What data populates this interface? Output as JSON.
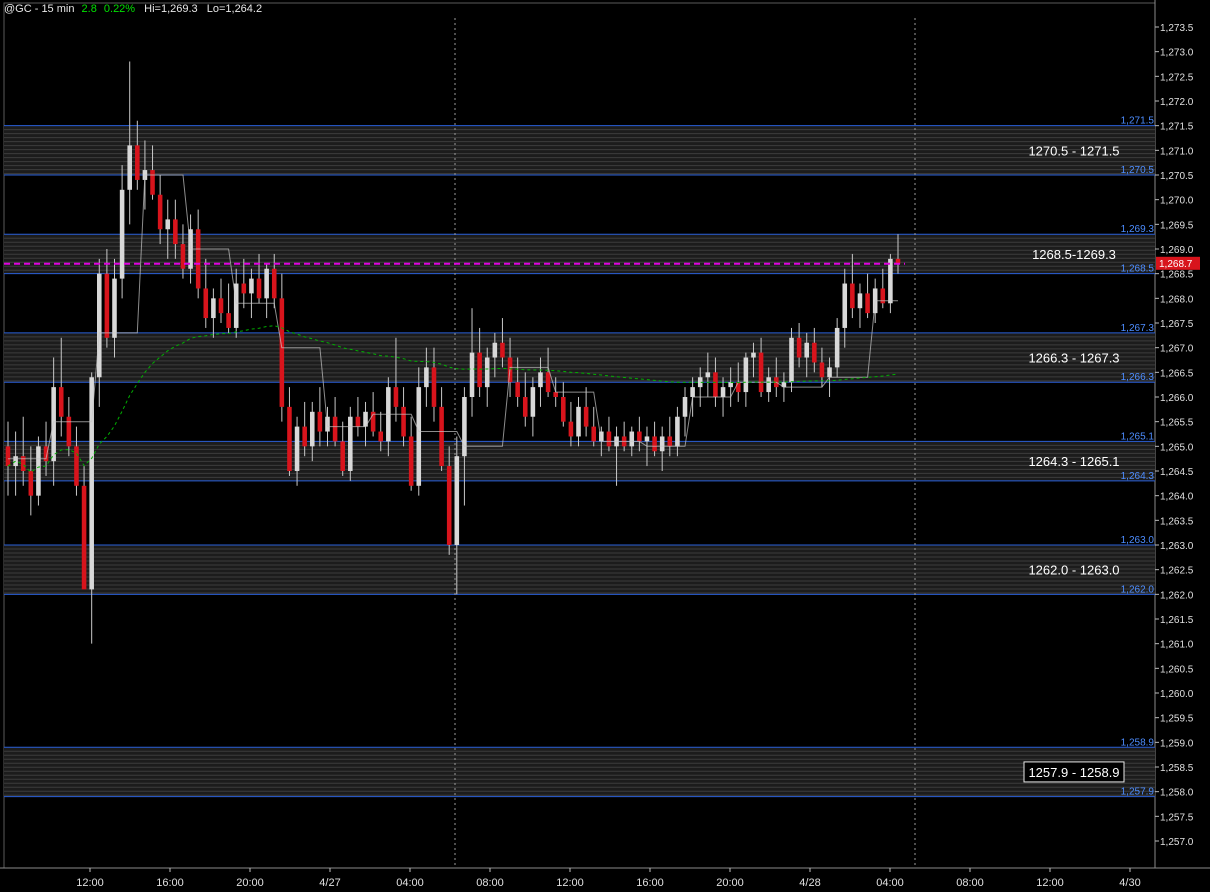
{
  "header": {
    "symbol": "@GC - 15 min",
    "change": "2.8",
    "change_pct": "0.22%",
    "high": "Hi=1,269.3",
    "low": "Lo=1,264.2"
  },
  "colors": {
    "background": "#000000",
    "zone_line": "#2a5fd8",
    "zone_label": "#4d8dff",
    "up_candle": "#d8d8d8",
    "down_candle": "#d8141c",
    "current_price_line": "#e000e0",
    "avg_line": "#00b000",
    "session_line": "#c8c8c8",
    "price_tag": "#d8141c"
  },
  "chart_data": {
    "type": "candlestick",
    "title": "@GC - 15 min",
    "x_ticks": [
      "12:00",
      "16:00",
      "20:00",
      "4/27",
      "04:00",
      "08:00",
      "12:00",
      "16:00",
      "20:00",
      "4/28",
      "04:00",
      "08:00",
      "12:00",
      "4/30"
    ],
    "y_ticks": [
      "1,257.0",
      "1,257.5",
      "1,258.0",
      "1,258.5",
      "1,259.0",
      "1,259.5",
      "1,260.0",
      "1,260.5",
      "1,261.0",
      "1,261.5",
      "1,262.0",
      "1,262.5",
      "1,263.0",
      "1,263.5",
      "1,264.0",
      "1,264.5",
      "1,265.0",
      "1,265.5",
      "1,266.0",
      "1,266.5",
      "1,267.0",
      "1,267.5",
      "1,268.0",
      "1,268.5",
      "1,269.0",
      "1,269.5",
      "1,270.0",
      "1,270.5",
      "1,271.0",
      "1,271.5",
      "1,272.0",
      "1,272.5",
      "1,273.0",
      "1,273.5"
    ],
    "ylim": [
      1256.6,
      1273.8
    ],
    "current_price": "1,268.7",
    "current_price_value": 1268.7,
    "zones": [
      {
        "label": "1270.5 - 1271.5",
        "low": 1270.5,
        "high": 1271.5,
        "low_label": "1,270.5",
        "high_label": "1,271.5",
        "boxed": false
      },
      {
        "label": "1268.5-1269.3",
        "low": 1268.5,
        "high": 1269.3,
        "low_label": "1,268.5",
        "high_label": "1,269.3",
        "boxed": false
      },
      {
        "label": "1266.3 - 1267.3",
        "low": 1266.3,
        "high": 1267.3,
        "low_label": "1,266.3",
        "high_label": "1,267.3",
        "boxed": false
      },
      {
        "label": "1264.3 - 1265.1",
        "low": 1264.3,
        "high": 1265.1,
        "low_label": "1,264.3",
        "high_label": "1,265.1",
        "boxed": false
      },
      {
        "label": "1262.0 - 1263.0",
        "low": 1262.0,
        "high": 1263.0,
        "low_label": "1,262.0",
        "high_label": "1,263.0",
        "boxed": false
      },
      {
        "label": "1257.9 - 1258.9",
        "low": 1257.9,
        "high": 1258.9,
        "low_label": "1,257.9",
        "high_label": "1,258.9",
        "boxed": true
      }
    ],
    "candles": [
      {
        "o": 1265.0,
        "h": 1265.5,
        "l": 1264.0,
        "c": 1264.6
      },
      {
        "o": 1264.6,
        "h": 1265.3,
        "l": 1264.0,
        "c": 1264.8
      },
      {
        "o": 1264.8,
        "h": 1265.6,
        "l": 1264.2,
        "c": 1264.5
      },
      {
        "o": 1264.5,
        "h": 1265.0,
        "l": 1263.6,
        "c": 1264.0
      },
      {
        "o": 1264.0,
        "h": 1265.2,
        "l": 1263.8,
        "c": 1265.0
      },
      {
        "o": 1265.0,
        "h": 1265.5,
        "l": 1264.4,
        "c": 1264.7
      },
      {
        "o": 1264.7,
        "h": 1266.8,
        "l": 1264.2,
        "c": 1266.2
      },
      {
        "o": 1266.2,
        "h": 1267.2,
        "l": 1265.2,
        "c": 1265.6
      },
      {
        "o": 1265.6,
        "h": 1266.0,
        "l": 1264.8,
        "c": 1265.0
      },
      {
        "o": 1265.0,
        "h": 1265.4,
        "l": 1264.0,
        "c": 1264.2
      },
      {
        "o": 1264.2,
        "h": 1264.6,
        "l": 1262.2,
        "c": 1262.1
      },
      {
        "o": 1262.1,
        "h": 1266.5,
        "l": 1261.0,
        "c": 1266.4
      },
      {
        "o": 1266.4,
        "h": 1268.8,
        "l": 1265.8,
        "c": 1268.5
      },
      {
        "o": 1268.5,
        "h": 1269.0,
        "l": 1267.0,
        "c": 1267.2
      },
      {
        "o": 1267.2,
        "h": 1268.8,
        "l": 1266.8,
        "c": 1268.4
      },
      {
        "o": 1268.4,
        "h": 1270.7,
        "l": 1268.0,
        "c": 1270.2
      },
      {
        "o": 1270.2,
        "h": 1272.8,
        "l": 1269.5,
        "c": 1271.1
      },
      {
        "o": 1271.1,
        "h": 1271.6,
        "l": 1270.2,
        "c": 1270.4
      },
      {
        "o": 1270.4,
        "h": 1271.2,
        "l": 1269.8,
        "c": 1270.6
      },
      {
        "o": 1270.6,
        "h": 1271.1,
        "l": 1270.0,
        "c": 1270.1
      },
      {
        "o": 1270.1,
        "h": 1270.5,
        "l": 1269.1,
        "c": 1269.4
      },
      {
        "o": 1269.4,
        "h": 1270.0,
        "l": 1268.8,
        "c": 1269.6
      },
      {
        "o": 1269.6,
        "h": 1270.0,
        "l": 1268.8,
        "c": 1269.1
      },
      {
        "o": 1269.1,
        "h": 1269.5,
        "l": 1268.4,
        "c": 1268.6
      },
      {
        "o": 1268.6,
        "h": 1269.7,
        "l": 1268.3,
        "c": 1269.4
      },
      {
        "o": 1269.4,
        "h": 1269.8,
        "l": 1268.0,
        "c": 1268.2
      },
      {
        "o": 1268.2,
        "h": 1268.8,
        "l": 1267.4,
        "c": 1267.6
      },
      {
        "o": 1267.6,
        "h": 1268.2,
        "l": 1267.2,
        "c": 1268.0
      },
      {
        "o": 1268.0,
        "h": 1268.4,
        "l": 1267.5,
        "c": 1267.7
      },
      {
        "o": 1267.7,
        "h": 1268.3,
        "l": 1267.3,
        "c": 1267.4
      },
      {
        "o": 1267.4,
        "h": 1268.6,
        "l": 1267.2,
        "c": 1268.3
      },
      {
        "o": 1268.3,
        "h": 1268.8,
        "l": 1267.8,
        "c": 1268.1
      },
      {
        "o": 1268.1,
        "h": 1268.6,
        "l": 1267.6,
        "c": 1268.4
      },
      {
        "o": 1268.4,
        "h": 1268.9,
        "l": 1267.9,
        "c": 1268.0
      },
      {
        "o": 1268.0,
        "h": 1268.7,
        "l": 1267.6,
        "c": 1268.6
      },
      {
        "o": 1268.6,
        "h": 1268.9,
        "l": 1267.8,
        "c": 1268.0
      },
      {
        "o": 1268.0,
        "h": 1268.5,
        "l": 1265.5,
        "c": 1265.8
      },
      {
        "o": 1265.8,
        "h": 1266.2,
        "l": 1264.4,
        "c": 1264.5
      },
      {
        "o": 1264.5,
        "h": 1265.6,
        "l": 1264.2,
        "c": 1265.4
      },
      {
        "o": 1265.4,
        "h": 1265.9,
        "l": 1264.8,
        "c": 1265.0
      },
      {
        "o": 1265.0,
        "h": 1265.9,
        "l": 1264.7,
        "c": 1265.7
      },
      {
        "o": 1265.7,
        "h": 1266.2,
        "l": 1265.0,
        "c": 1265.3
      },
      {
        "o": 1265.3,
        "h": 1265.8,
        "l": 1265.0,
        "c": 1265.6
      },
      {
        "o": 1265.6,
        "h": 1266.0,
        "l": 1265.0,
        "c": 1265.1
      },
      {
        "o": 1265.1,
        "h": 1265.5,
        "l": 1264.4,
        "c": 1264.5
      },
      {
        "o": 1264.5,
        "h": 1265.8,
        "l": 1264.3,
        "c": 1265.6
      },
      {
        "o": 1265.6,
        "h": 1266.0,
        "l": 1265.2,
        "c": 1265.4
      },
      {
        "o": 1265.4,
        "h": 1265.9,
        "l": 1265.0,
        "c": 1265.7
      },
      {
        "o": 1265.7,
        "h": 1266.1,
        "l": 1265.2,
        "c": 1265.3
      },
      {
        "o": 1265.3,
        "h": 1265.7,
        "l": 1264.9,
        "c": 1265.1
      },
      {
        "o": 1265.1,
        "h": 1266.4,
        "l": 1264.8,
        "c": 1266.2
      },
      {
        "o": 1266.2,
        "h": 1267.2,
        "l": 1265.5,
        "c": 1265.8
      },
      {
        "o": 1265.8,
        "h": 1266.2,
        "l": 1265.0,
        "c": 1265.2
      },
      {
        "o": 1265.2,
        "h": 1265.6,
        "l": 1264.1,
        "c": 1264.2
      },
      {
        "o": 1264.2,
        "h": 1266.6,
        "l": 1264.0,
        "c": 1266.2
      },
      {
        "o": 1266.2,
        "h": 1267.0,
        "l": 1265.8,
        "c": 1266.6
      },
      {
        "o": 1266.6,
        "h": 1267.0,
        "l": 1265.5,
        "c": 1265.8
      },
      {
        "o": 1265.8,
        "h": 1266.2,
        "l": 1264.5,
        "c": 1264.6
      },
      {
        "o": 1264.6,
        "h": 1265.0,
        "l": 1262.8,
        "c": 1263.0
      },
      {
        "o": 1263.0,
        "h": 1265.2,
        "l": 1262.0,
        "c": 1264.8
      },
      {
        "o": 1264.8,
        "h": 1266.2,
        "l": 1263.8,
        "c": 1266.0
      },
      {
        "o": 1266.0,
        "h": 1267.8,
        "l": 1265.6,
        "c": 1266.9
      },
      {
        "o": 1266.9,
        "h": 1267.4,
        "l": 1266.0,
        "c": 1266.2
      },
      {
        "o": 1266.2,
        "h": 1267.0,
        "l": 1265.8,
        "c": 1266.8
      },
      {
        "o": 1266.8,
        "h": 1267.3,
        "l": 1266.4,
        "c": 1267.1
      },
      {
        "o": 1267.1,
        "h": 1267.6,
        "l": 1266.6,
        "c": 1266.8
      },
      {
        "o": 1266.8,
        "h": 1267.2,
        "l": 1266.0,
        "c": 1266.3
      },
      {
        "o": 1266.3,
        "h": 1266.8,
        "l": 1265.8,
        "c": 1266.0
      },
      {
        "o": 1266.0,
        "h": 1266.5,
        "l": 1265.4,
        "c": 1265.6
      },
      {
        "o": 1265.6,
        "h": 1266.4,
        "l": 1265.2,
        "c": 1266.2
      },
      {
        "o": 1266.2,
        "h": 1266.8,
        "l": 1265.8,
        "c": 1266.5
      },
      {
        "o": 1266.5,
        "h": 1267.0,
        "l": 1266.0,
        "c": 1266.1
      },
      {
        "o": 1266.1,
        "h": 1266.4,
        "l": 1265.8,
        "c": 1266.0
      },
      {
        "o": 1266.0,
        "h": 1266.3,
        "l": 1265.4,
        "c": 1265.5
      },
      {
        "o": 1265.5,
        "h": 1265.9,
        "l": 1265.0,
        "c": 1265.2
      },
      {
        "o": 1265.2,
        "h": 1266.0,
        "l": 1265.0,
        "c": 1265.8
      },
      {
        "o": 1265.8,
        "h": 1266.2,
        "l": 1265.2,
        "c": 1265.4
      },
      {
        "o": 1265.4,
        "h": 1265.8,
        "l": 1265.0,
        "c": 1265.1
      },
      {
        "o": 1265.1,
        "h": 1265.4,
        "l": 1264.8,
        "c": 1265.3
      },
      {
        "o": 1265.3,
        "h": 1265.6,
        "l": 1264.9,
        "c": 1265.0
      },
      {
        "o": 1265.0,
        "h": 1265.4,
        "l": 1264.2,
        "c": 1265.2
      },
      {
        "o": 1265.2,
        "h": 1265.5,
        "l": 1264.9,
        "c": 1265.0
      },
      {
        "o": 1265.0,
        "h": 1265.4,
        "l": 1264.8,
        "c": 1265.3
      },
      {
        "o": 1265.3,
        "h": 1265.6,
        "l": 1264.9,
        "c": 1265.1
      },
      {
        "o": 1265.1,
        "h": 1265.4,
        "l": 1264.6,
        "c": 1265.2
      },
      {
        "o": 1265.2,
        "h": 1265.5,
        "l": 1264.8,
        "c": 1264.9
      },
      {
        "o": 1264.9,
        "h": 1265.4,
        "l": 1264.5,
        "c": 1265.2
      },
      {
        "o": 1265.2,
        "h": 1265.6,
        "l": 1264.8,
        "c": 1265.0
      },
      {
        "o": 1265.0,
        "h": 1265.8,
        "l": 1264.8,
        "c": 1265.6
      },
      {
        "o": 1265.6,
        "h": 1266.2,
        "l": 1265.2,
        "c": 1266.0
      },
      {
        "o": 1266.0,
        "h": 1266.4,
        "l": 1265.6,
        "c": 1266.2
      },
      {
        "o": 1266.2,
        "h": 1266.6,
        "l": 1265.8,
        "c": 1266.4
      },
      {
        "o": 1266.4,
        "h": 1266.9,
        "l": 1266.0,
        "c": 1266.5
      },
      {
        "o": 1266.5,
        "h": 1266.8,
        "l": 1265.8,
        "c": 1266.0
      },
      {
        "o": 1266.0,
        "h": 1266.4,
        "l": 1265.6,
        "c": 1266.2
      },
      {
        "o": 1266.2,
        "h": 1266.6,
        "l": 1265.8,
        "c": 1266.3
      },
      {
        "o": 1266.3,
        "h": 1266.7,
        "l": 1265.9,
        "c": 1266.1
      },
      {
        "o": 1266.1,
        "h": 1266.9,
        "l": 1265.8,
        "c": 1266.8
      },
      {
        "o": 1266.8,
        "h": 1267.1,
        "l": 1266.4,
        "c": 1266.9
      },
      {
        "o": 1266.9,
        "h": 1267.2,
        "l": 1266.0,
        "c": 1266.1
      },
      {
        "o": 1266.1,
        "h": 1266.6,
        "l": 1265.9,
        "c": 1266.4
      },
      {
        "o": 1266.4,
        "h": 1266.8,
        "l": 1266.0,
        "c": 1266.2
      },
      {
        "o": 1266.2,
        "h": 1266.5,
        "l": 1265.9,
        "c": 1266.3
      },
      {
        "o": 1266.3,
        "h": 1267.4,
        "l": 1266.1,
        "c": 1267.2
      },
      {
        "o": 1267.2,
        "h": 1267.5,
        "l": 1266.6,
        "c": 1266.8
      },
      {
        "o": 1266.8,
        "h": 1267.3,
        "l": 1266.4,
        "c": 1267.1
      },
      {
        "o": 1267.1,
        "h": 1267.4,
        "l": 1266.5,
        "c": 1266.7
      },
      {
        "o": 1266.7,
        "h": 1267.0,
        "l": 1266.2,
        "c": 1266.4
      },
      {
        "o": 1266.4,
        "h": 1266.8,
        "l": 1266.0,
        "c": 1266.6
      },
      {
        "o": 1266.6,
        "h": 1267.6,
        "l": 1266.4,
        "c": 1267.4
      },
      {
        "o": 1267.4,
        "h": 1268.6,
        "l": 1267.0,
        "c": 1268.3
      },
      {
        "o": 1268.3,
        "h": 1268.9,
        "l": 1267.6,
        "c": 1267.8
      },
      {
        "o": 1267.8,
        "h": 1268.3,
        "l": 1267.4,
        "c": 1268.1
      },
      {
        "o": 1268.1,
        "h": 1268.5,
        "l": 1267.6,
        "c": 1267.7
      },
      {
        "o": 1267.7,
        "h": 1268.4,
        "l": 1267.5,
        "c": 1268.2
      },
      {
        "o": 1268.2,
        "h": 1268.6,
        "l": 1267.8,
        "c": 1267.9
      },
      {
        "o": 1267.9,
        "h": 1268.9,
        "l": 1267.7,
        "c": 1268.8
      },
      {
        "o": 1268.8,
        "h": 1269.3,
        "l": 1268.5,
        "c": 1268.7
      }
    ]
  }
}
